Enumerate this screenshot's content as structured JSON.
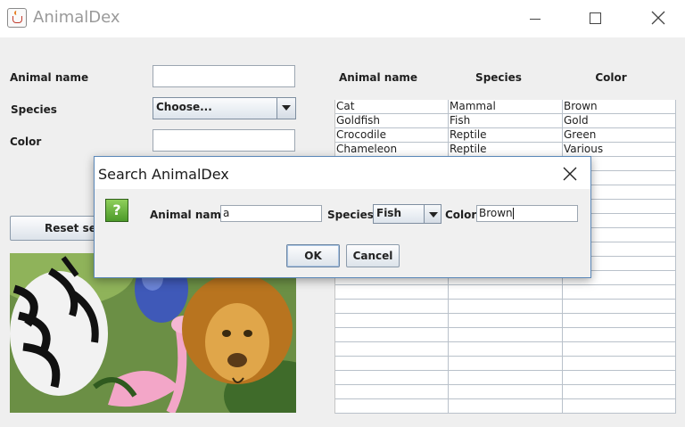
{
  "window": {
    "title": "AnimalDex"
  },
  "form": {
    "name_label": "Animal name",
    "species_label": "Species",
    "species_value": "Choose...",
    "color_label": "Color",
    "name_value": "",
    "color_value": "",
    "reset_button": "Reset search"
  },
  "table": {
    "headers": [
      "Animal name",
      "Species",
      "Color"
    ],
    "rows": [
      [
        "Cat",
        "Mammal",
        "Brown"
      ],
      [
        "Goldfish",
        "Fish",
        "Gold"
      ],
      [
        "Crocodile",
        "Reptile",
        "Green"
      ],
      [
        "Chameleon",
        "Reptile",
        "Various"
      ]
    ]
  },
  "dialog": {
    "title": "Search AnimalDex",
    "icon": "question-icon",
    "icon_glyph": "?",
    "name_label": "Animal name",
    "name_value": "a",
    "species_label": "Species",
    "species_value": "Fish",
    "color_label": "Color",
    "color_value": "Brown",
    "ok_label": "OK",
    "cancel_label": "Cancel"
  },
  "colors": {
    "dialog_border": "#5b88b9",
    "accent": "#4c9a2a"
  }
}
